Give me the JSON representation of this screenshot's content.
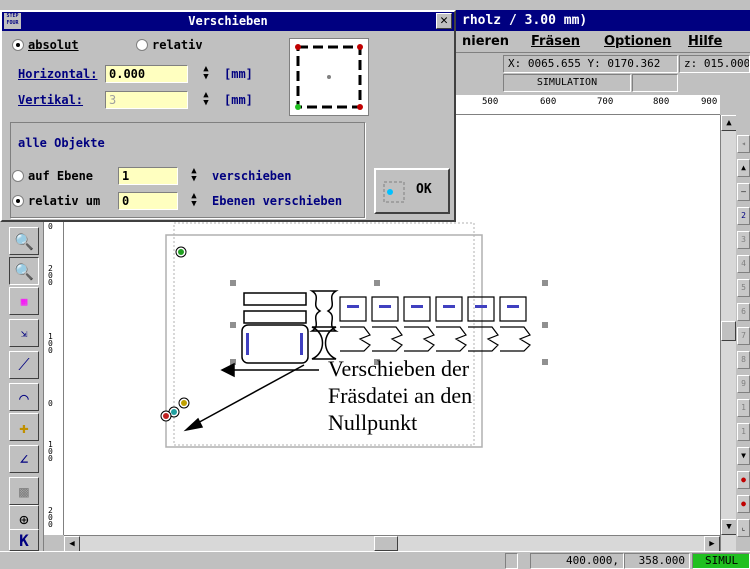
{
  "app": {
    "title": "rholz / 3.00 mm)",
    "menu": [
      "nieren",
      "Fräsen",
      "Optionen",
      "Hilfe"
    ],
    "coord_readout": "X: 0065.655 Y: 0170.362",
    "z_readout": "z: 015.000",
    "mode": "SIMULATION",
    "hruler_ticks": [
      "500",
      "600",
      "700",
      "800",
      "900"
    ],
    "vruler_ticks": [
      "0",
      "200",
      "100",
      "0",
      "100",
      "200"
    ],
    "status_coords": "400.000,",
    "status_coords2": "358.000",
    "status_mode": "SIMUL"
  },
  "dialog": {
    "title": "Verschieben",
    "logo": "STEP FOUR",
    "close": "✕",
    "radio_absolut": "absolut",
    "radio_relativ": "relativ",
    "horizontal_label": "Horizontal:",
    "horizontal_value": "0.000",
    "vertikal_label": "Vertikal:",
    "vertikal_value": "3",
    "unit": "[mm]",
    "group_title": "alle Objekte",
    "auf_ebene_label": "auf Ebene",
    "auf_ebene_value": "1",
    "verschieben": "verschieben",
    "relativ_um_label": "relativ um",
    "relativ_um_value": "0",
    "ebenen_verschieben": "Ebenen verschieben",
    "ok_label": "OK"
  },
  "annotation": {
    "line1": "Verschieben der",
    "line2": "Fräsdatei an den",
    "line3": "Nullpunkt"
  }
}
